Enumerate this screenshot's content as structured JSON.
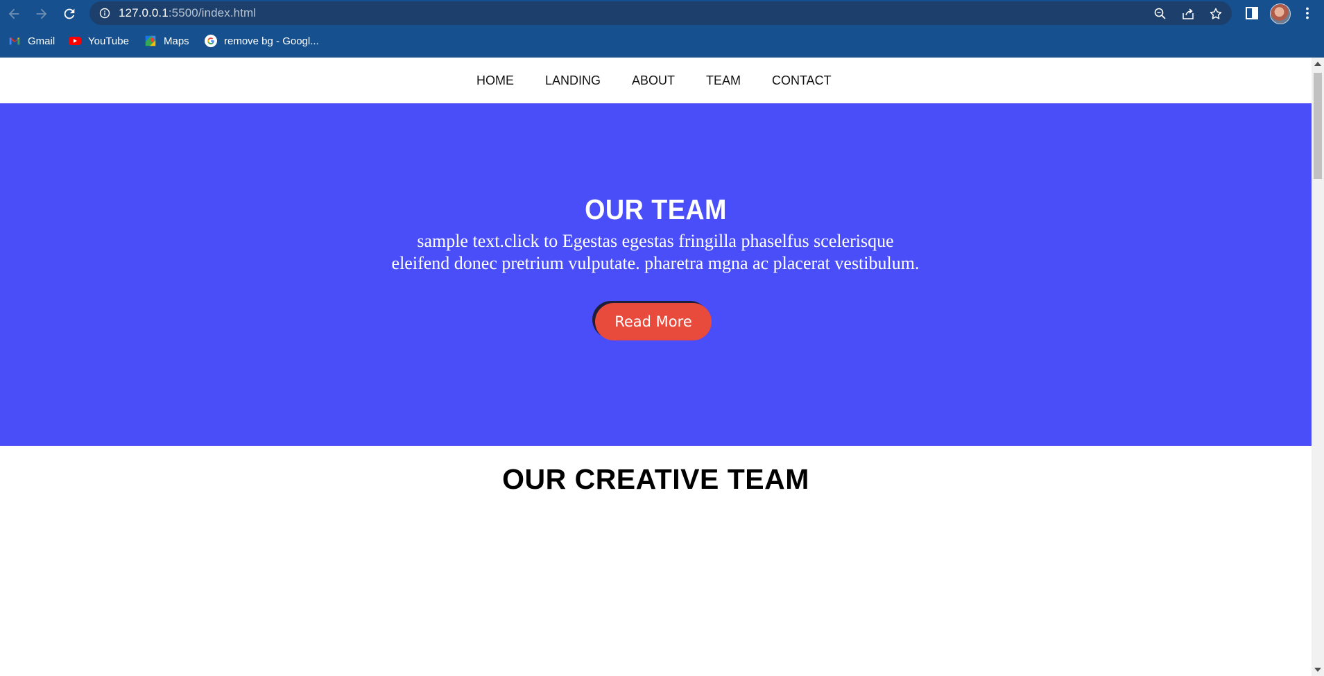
{
  "browser": {
    "url_host": "127.0.0.1",
    "url_path": ":5500/index.html",
    "bookmarks": [
      {
        "label": "Gmail",
        "icon": "gmail-icon"
      },
      {
        "label": "YouTube",
        "icon": "youtube-icon"
      },
      {
        "label": "Maps",
        "icon": "maps-icon"
      },
      {
        "label": "remove bg - Googl...",
        "icon": "google-icon"
      }
    ]
  },
  "site": {
    "nav": [
      "HOME",
      "LANDING",
      "ABOUT",
      "TEAM",
      "CONTACT"
    ],
    "hero": {
      "title": "OUR TEAM",
      "text_line1": "sample text.click to Egestas egestas fringilla phaselfus scelerisque",
      "text_line2": "eleifend donec pretrium vulputate. pharetra mgna ac placerat vestibulum.",
      "button_label": "Read More"
    },
    "section_title": "OUR CREATIVE TEAM"
  },
  "colors": {
    "chrome": "#16508e",
    "hero_bg": "#4a4ef9",
    "button": "#e84a3c"
  }
}
